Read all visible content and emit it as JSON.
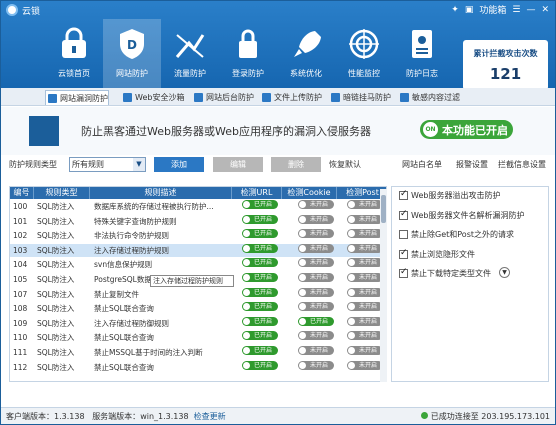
{
  "app": {
    "title": "云锁",
    "skin_label": "功能箱"
  },
  "colors": {
    "header": "#1f73bd",
    "accent": "#2b78c4",
    "on": "#2f9a2e",
    "off": "#8c8c8c"
  },
  "nav": {
    "items": [
      {
        "label": "云锁首页",
        "icon": "lock-icon"
      },
      {
        "label": "网站防护",
        "icon": "shield-icon"
      },
      {
        "label": "流量防护",
        "icon": "traffic-icon"
      },
      {
        "label": "登录防护",
        "icon": "padlock-icon"
      },
      {
        "label": "系统优化",
        "icon": "rocket-icon"
      },
      {
        "label": "性能监控",
        "icon": "target-icon"
      },
      {
        "label": "防护日志",
        "icon": "log-icon"
      }
    ]
  },
  "counter": {
    "title": "累计拦截攻击次数",
    "value": "121"
  },
  "subtabs": [
    "网站漏洞防护",
    "Web安全沙箱",
    "网站后台防护",
    "文件上传防护",
    "暗链挂马防护",
    "敏感内容过滤"
  ],
  "banner": {
    "text": "防止黑客通过Web服务器或Web应用程序的漏洞入侵服务器",
    "status": "本功能已开启",
    "status_icon": "ON"
  },
  "controls": {
    "type_label": "防护规则类型",
    "type_value": "所有规则",
    "add": "添加",
    "edit": "编辑",
    "delete": "删除",
    "restore": "恢复默认",
    "whitelist": "网站白名单",
    "report": "报警设置",
    "block_page": "拦截信息设置"
  },
  "table": {
    "headers": [
      "编号",
      "规则类型",
      "规则描述",
      "检测URL",
      "检测Cookie",
      "检测Post"
    ],
    "on_text": "已开启",
    "off_text": "未开启",
    "rows": [
      {
        "id": "100",
        "type": "SQL防注入",
        "desc": "数据库系统的存储过程被执行防护...",
        "url": true,
        "cookie": false,
        "post": false
      },
      {
        "id": "101",
        "type": "SQL防注入",
        "desc": "特殊关键字查询防护规则",
        "url": true,
        "cookie": false,
        "post": false
      },
      {
        "id": "102",
        "type": "SQL防注入",
        "desc": "非法执行命令防护规则",
        "url": true,
        "cookie": false,
        "post": false
      },
      {
        "id": "103",
        "type": "SQL防注入",
        "desc": "注入存储过程防护规则",
        "url": true,
        "cookie": false,
        "post": false
      },
      {
        "id": "104",
        "type": "SQL防注入",
        "desc": "svn信息保护规则",
        "url": true,
        "cookie": false,
        "post": false
      },
      {
        "id": "105",
        "type": "SQL防注入",
        "desc": "PostgreSQL数据",
        "url": true,
        "cookie": false,
        "post": false
      },
      {
        "id": "107",
        "type": "SQL防注入",
        "desc": "禁止复制文件",
        "url": true,
        "cookie": false,
        "post": false
      },
      {
        "id": "108",
        "type": "SQL防注入",
        "desc": "禁止SQL联合查询",
        "url": true,
        "cookie": false,
        "post": false
      },
      {
        "id": "109",
        "type": "SQL防注入",
        "desc": "注入存储过程防御规则",
        "url": true,
        "cookie": true,
        "post": false
      },
      {
        "id": "110",
        "type": "SQL防注入",
        "desc": "禁止SQL联合查询",
        "url": true,
        "cookie": false,
        "post": false
      },
      {
        "id": "111",
        "type": "SQL防注入",
        "desc": "禁止MSSQL基于时间的注入判断",
        "url": true,
        "cookie": false,
        "post": false
      },
      {
        "id": "112",
        "type": "SQL防注入",
        "desc": "禁止SQL联合查询",
        "url": true,
        "cookie": false,
        "post": false
      }
    ],
    "tooltip": "注入存储过程防护规则"
  },
  "options": [
    {
      "label": "Web服务器溢出攻击防护",
      "checked": true
    },
    {
      "label": "Web服务器文件名解析漏洞防护",
      "checked": true
    },
    {
      "label": "禁止除Get和Post之外的请求",
      "checked": false
    },
    {
      "label": "禁止浏览隐形文件",
      "checked": true
    },
    {
      "label": "禁止下载特定类型文件",
      "checked": true
    }
  ],
  "footer": {
    "client_label": "客户端版本：",
    "client_version": "1.3.138",
    "server_label": "服务端版本：",
    "server_version": "win_1.3.138",
    "update": "检查更新",
    "connection": "已成功连接至 203.195.173.101"
  }
}
